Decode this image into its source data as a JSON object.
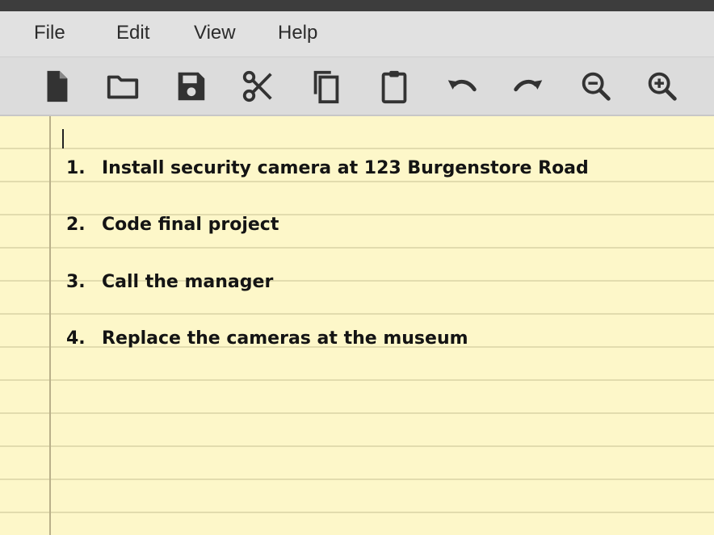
{
  "menu": {
    "items": [
      {
        "label": "File"
      },
      {
        "label": "Edit"
      },
      {
        "label": "View"
      },
      {
        "label": "Help"
      }
    ]
  },
  "toolbar": {
    "icon_color": "#333333",
    "buttons": [
      {
        "icon": "new-document-icon"
      },
      {
        "icon": "open-folder-icon"
      },
      {
        "icon": "save-icon"
      },
      {
        "icon": "cut-icon"
      },
      {
        "icon": "copy-icon"
      },
      {
        "icon": "paste-icon"
      },
      {
        "icon": "undo-icon"
      },
      {
        "icon": "redo-icon"
      },
      {
        "icon": "zoom-out-icon"
      },
      {
        "icon": "zoom-in-icon"
      }
    ]
  },
  "document": {
    "background": "#fdf7c9",
    "items": [
      {
        "number": "1.",
        "text": "Install security camera at 123 Burgenstore Road"
      },
      {
        "number": "2.",
        "text": "Code final project"
      },
      {
        "number": "3.",
        "text": "Call the manager"
      },
      {
        "number": "4.",
        "text": "Replace the cameras at the museum"
      }
    ]
  }
}
